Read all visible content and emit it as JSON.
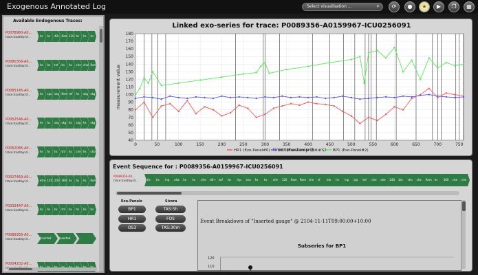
{
  "app": {
    "title": "Exogenous Annotated Log"
  },
  "toolbar": {
    "select_label": "Select visualisation ...",
    "caret": "▾",
    "icons": [
      "refresh-icon",
      "drop-icon",
      "star-icon",
      "play-icon",
      "copy-icon",
      "grid-icon"
    ]
  },
  "left_panel": {
    "title": "Available Endogenous Traces:",
    "trace_sub": "trace:lcoatlay:id...",
    "traces": [
      {
        "id": "P0078960-A0...",
        "chevrons": [
          "hs",
          "hs",
          "40+",
          "Rem",
          "120",
          "hs",
          "hs",
          "hs"
        ]
      },
      {
        "id": "P0080356-A0...",
        "chevrons": [
          "hs",
          "hs",
          "tnf",
          "hs",
          "hs",
          "che",
          "chol",
          "Rem"
        ]
      },
      {
        "id": "P0085145-A0...",
        "chevrons": [
          "hs",
          "spu",
          "skg",
          "Rem",
          "tnf",
          "hs",
          "skg",
          "skg"
        ]
      },
      {
        "id": "P0052546-A0...",
        "chevrons": [
          "hs",
          "hs",
          "skg",
          "skg",
          "hs",
          "skg",
          "hs",
          "skg"
        ]
      },
      {
        "id": "P0052085-A0...",
        "chevrons": [
          "hs",
          "hs",
          "hs",
          "tnf",
          "hs",
          "che",
          "hs",
          "chol"
        ]
      },
      {
        "id": "P0027469-A0...",
        "chevrons": [
          "40+",
          "120",
          "240",
          "360",
          "hs",
          "hs",
          "hs",
          "Rem"
        ]
      },
      {
        "id": "P0032447-A0...",
        "chevrons": [
          "hs",
          "hs",
          "hs",
          "tnf",
          "hs",
          "hs",
          "hs",
          "hs"
        ]
      },
      {
        "id": "P0089356-A0...",
        "chevrons": [
          "Inserted gauge",
          "Inserted gauge",
          "..."
        ]
      },
      {
        "id": "P0004202-A0...",
        "chevrons": [
          "hs",
          "hs",
          "hs",
          "hs",
          "hs",
          "hs",
          "hs",
          "hs"
        ]
      }
    ]
  },
  "chart_panel": {
    "chart_data": {
      "type": "line",
      "title": "Linked exo-series for trace: P0089356-A0159967-ICU0256091",
      "xlabel": "time:timestamp (hours)",
      "ylabel": "measurement value",
      "xlim": [
        0,
        760
      ],
      "ylim": [
        40,
        180
      ],
      "xticks": [
        0,
        50,
        100,
        150,
        200,
        250,
        300,
        350,
        400,
        450,
        500,
        550,
        600,
        650,
        700,
        750
      ],
      "yticks": [
        40,
        50,
        60,
        70,
        80,
        90,
        100,
        110,
        120,
        130,
        140,
        150,
        160,
        170,
        180
      ],
      "grid": true,
      "legend_position": "bottom",
      "series": [
        {
          "name": "HR1 (Exo-Panel#0)",
          "color": "#ff5555",
          "x": [
            0,
            20,
            40,
            60,
            80,
            100,
            120,
            140,
            160,
            180,
            200,
            220,
            240,
            260,
            280,
            300,
            320,
            340,
            360,
            380,
            400,
            420,
            440,
            460,
            480,
            500,
            520,
            540,
            560,
            580,
            600,
            620,
            640,
            660,
            680,
            700,
            720,
            740,
            760
          ],
          "y": [
            80,
            90,
            70,
            85,
            88,
            78,
            92,
            75,
            84,
            80,
            72,
            76,
            86,
            82,
            70,
            74,
            82,
            85,
            88,
            86,
            90,
            88,
            87,
            85,
            78,
            72,
            62,
            70,
            66,
            74,
            84,
            80,
            95,
            100,
            108,
            96,
            102,
            100,
            98
          ]
        },
        {
          "name": "OS3 (Exo-Panel#1)",
          "color": "#5555ff",
          "x": [
            0,
            20,
            40,
            60,
            80,
            100,
            120,
            140,
            160,
            180,
            200,
            220,
            240,
            260,
            280,
            300,
            320,
            340,
            360,
            380,
            400,
            420,
            440,
            460,
            480,
            500,
            520,
            540,
            560,
            580,
            600,
            620,
            640,
            660,
            680,
            700,
            720,
            740,
            760
          ],
          "y": [
            95,
            97,
            96,
            94,
            98,
            96,
            95,
            97,
            96,
            95,
            98,
            96,
            97,
            96,
            95,
            97,
            96,
            98,
            96,
            97,
            96,
            97,
            95,
            96,
            98,
            96,
            94,
            95,
            96,
            97,
            96,
            98,
            97,
            99,
            100,
            98,
            97,
            96,
            97
          ]
        },
        {
          "name": "BP1 (Exo-Panel#2)",
          "color": "#55ee55",
          "x": [
            0,
            10,
            20,
            30,
            40,
            60,
            100,
            150,
            200,
            250,
            280,
            290,
            300,
            310,
            350,
            400,
            450,
            500,
            520,
            530,
            540,
            560,
            580,
            600,
            620,
            640,
            660,
            680,
            700,
            720,
            740,
            760
          ],
          "y": [
            100,
            108,
            122,
            115,
            130,
            112,
            115,
            119,
            123,
            127,
            129,
            137,
            142,
            128,
            133,
            137,
            142,
            146,
            150,
            115,
            155,
            158,
            148,
            162,
            130,
            145,
            120,
            148,
            135,
            142,
            138,
            140
          ]
        }
      ],
      "vlines_x": [
        20,
        38,
        52,
        70,
        232,
        296,
        300,
        334,
        410,
        450,
        482,
        508,
        532,
        540,
        546,
        558,
        604,
        650,
        688,
        700,
        708,
        742,
        750
      ]
    }
  },
  "seq_panel": {
    "title": "Event Sequence for : P0089356-A0159967-ICU0256091",
    "trace_id": "P0089356-A0...",
    "trace_sub": "trace:lcoatlay:id...",
    "chevrons": [
      "hs",
      "hs",
      "Inp",
      "aha",
      "hs",
      "hs",
      "che",
      "40+",
      "tnf",
      "hs",
      "lnp",
      "cha",
      "hs",
      "hs",
      "che",
      "120",
      "Rem",
      "Rem",
      "che",
      "sf",
      "blo",
      "hs",
      "lnp",
      "aja",
      "tnf",
      "che",
      "che",
      "240",
      "blo",
      "che",
      "che",
      "Rem",
      "hs",
      "360",
      "che",
      "che"
    ],
    "exo_label": "Exo-Panels",
    "sicora_label": "Sicora",
    "exo_buttons": [
      "BP1",
      "HR1",
      "OS3"
    ],
    "sicora_buttons": [
      "TAS:5h",
      "FOS",
      "TAS:30m"
    ],
    "breakdown_title": "Event Breakdown of \"Inserted gauge\" @ 2104-11-11T09:00:00+10:00",
    "subseries_title": "Subseries for BP1",
    "sub_y_ticks": [
      "120",
      "110"
    ]
  }
}
